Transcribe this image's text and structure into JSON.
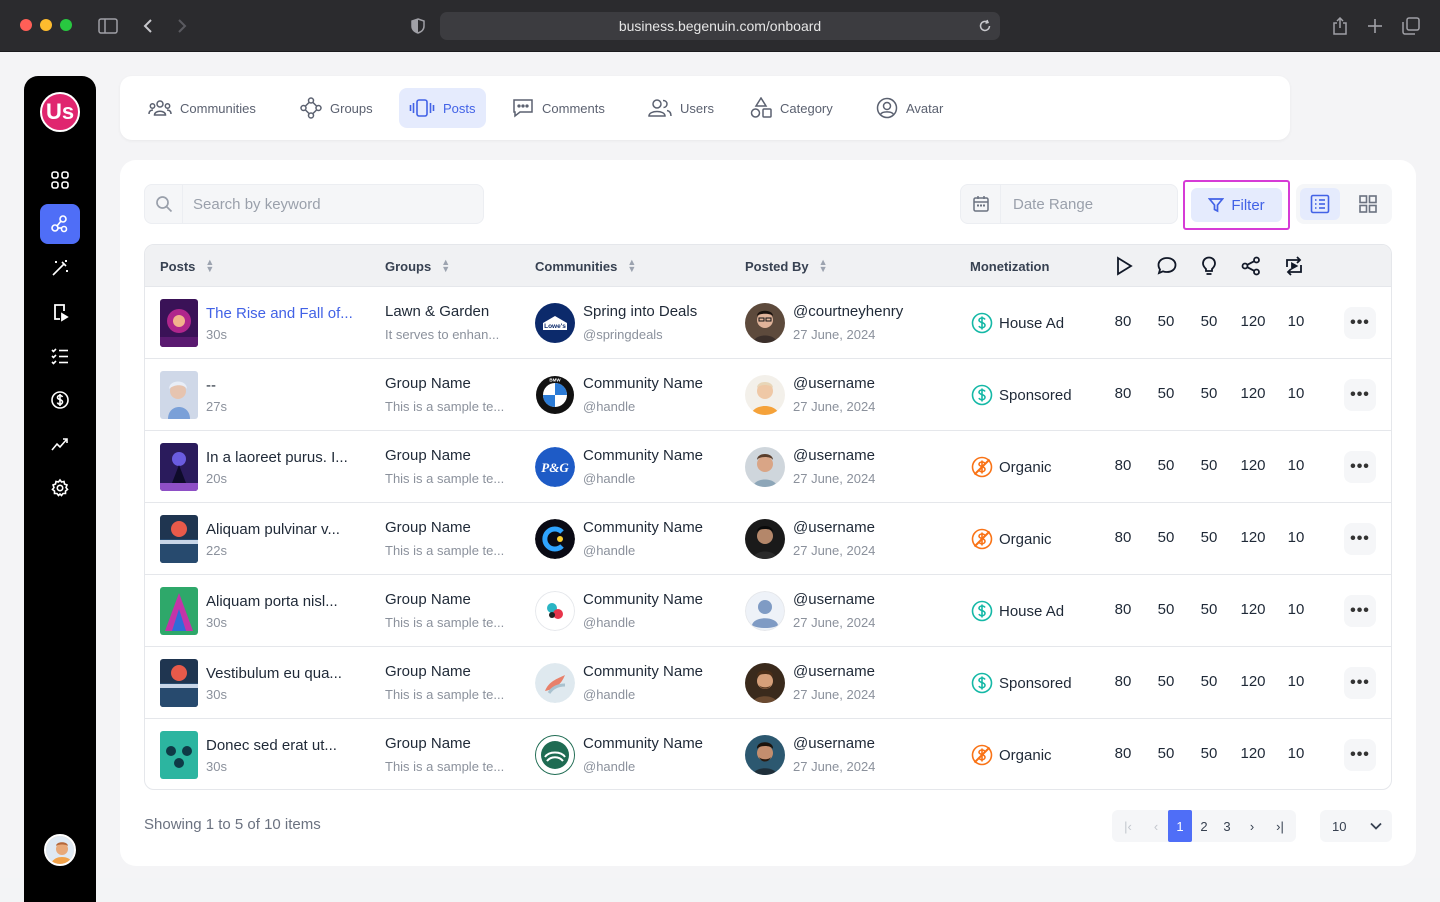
{
  "browser": {
    "url": "business.begenuin.com/onboard"
  },
  "app": {
    "logo_text": "Us"
  },
  "tabs": [
    {
      "label": "Communities",
      "icon": "people-group-icon"
    },
    {
      "label": "Groups",
      "icon": "group-nodes-icon"
    },
    {
      "label": "Posts",
      "icon": "posts-carousel-icon",
      "active": true
    },
    {
      "label": "Comments",
      "icon": "comment-box-icon"
    },
    {
      "label": "Users",
      "icon": "users-icon"
    },
    {
      "label": "Category",
      "icon": "category-shapes-icon"
    },
    {
      "label": "Avatar",
      "icon": "avatar-circle-icon"
    }
  ],
  "toolbar": {
    "search_placeholder": "Search by keyword",
    "date_placeholder": "Date Range",
    "filter_label": "Filter"
  },
  "table": {
    "headers": {
      "posts": "Posts",
      "groups": "Groups",
      "communities": "Communities",
      "posted_by": "Posted By",
      "monetization": "Monetization",
      "metric_icons": [
        "play-icon",
        "comment-icon",
        "bulb-icon",
        "share-icon",
        "repost-icon"
      ]
    },
    "rows": [
      {
        "title": "The Rise and Fall of...",
        "duration": "30s",
        "group": "Lawn & Garden",
        "group_desc": "It serves to enhan...",
        "community": "Spring into Deals",
        "handle": "@springdeals",
        "user": "@courtneyhenry",
        "date": "27 June, 2024",
        "monetization": "House Ad",
        "mon_type": "paid",
        "metrics": [
          "80",
          "50",
          "50",
          "120",
          "10"
        ],
        "logo_text": "Lowe's"
      },
      {
        "title": "--",
        "duration": "27s",
        "group": "Group Name",
        "group_desc": "This is a sample te...",
        "community": "Community Name",
        "handle": "@handle",
        "user": "@username",
        "date": "27 June, 2024",
        "monetization": "Sponsored",
        "mon_type": "paid",
        "metrics": [
          "80",
          "50",
          "50",
          "120",
          "10"
        ],
        "logo_text": "BMW"
      },
      {
        "title": "In a laoreet purus. I...",
        "duration": "20s",
        "group": "Group Name",
        "group_desc": "This is a sample te...",
        "community": "Community Name",
        "handle": "@handle",
        "user": "@username",
        "date": "27 June, 2024",
        "monetization": "Organic",
        "mon_type": "organic",
        "metrics": [
          "80",
          "50",
          "50",
          "120",
          "10"
        ],
        "logo_text": "P&G"
      },
      {
        "title": "Aliquam pulvinar v...",
        "duration": "22s",
        "group": "Group Name",
        "group_desc": "This is a sample te...",
        "community": "Community Name",
        "handle": "@handle",
        "user": "@username",
        "date": "27 June, 2024",
        "monetization": "Organic",
        "mon_type": "organic",
        "metrics": [
          "80",
          "50",
          "50",
          "120",
          "10"
        ],
        "logo_text": ""
      },
      {
        "title": "Aliquam porta nisl...",
        "duration": "30s",
        "group": "Group Name",
        "group_desc": "This is a sample te...",
        "community": "Community Name",
        "handle": "@handle",
        "user": "@username",
        "date": "27 June, 2024",
        "monetization": "House Ad",
        "mon_type": "paid",
        "metrics": [
          "80",
          "50",
          "50",
          "120",
          "10"
        ],
        "logo_text": ""
      },
      {
        "title": "Vestibulum eu qua...",
        "duration": "30s",
        "group": "Group Name",
        "group_desc": "This is a sample te...",
        "community": "Community Name",
        "handle": "@handle",
        "user": "@username",
        "date": "27 June, 2024",
        "monetization": "Sponsored",
        "mon_type": "paid",
        "metrics": [
          "80",
          "50",
          "50",
          "120",
          "10"
        ],
        "logo_text": ""
      },
      {
        "title": "Donec sed erat ut...",
        "duration": "30s",
        "group": "Group Name",
        "group_desc": "This is a sample te...",
        "community": "Community Name",
        "handle": "@handle",
        "user": "@username",
        "date": "27 June, 2024",
        "monetization": "Organic",
        "mon_type": "organic",
        "metrics": [
          "80",
          "50",
          "50",
          "120",
          "10"
        ],
        "logo_text": ""
      }
    ]
  },
  "footer": {
    "showing": "Showing 1 to 5 of 10 items",
    "pages": [
      "1",
      "2",
      "3"
    ],
    "current_page": "1",
    "per_page": "10"
  },
  "colors": {
    "accent": "#4f6ef7",
    "paid": "#14b8a6",
    "organic": "#f97316",
    "filter_highlight": "#d63bd6"
  }
}
